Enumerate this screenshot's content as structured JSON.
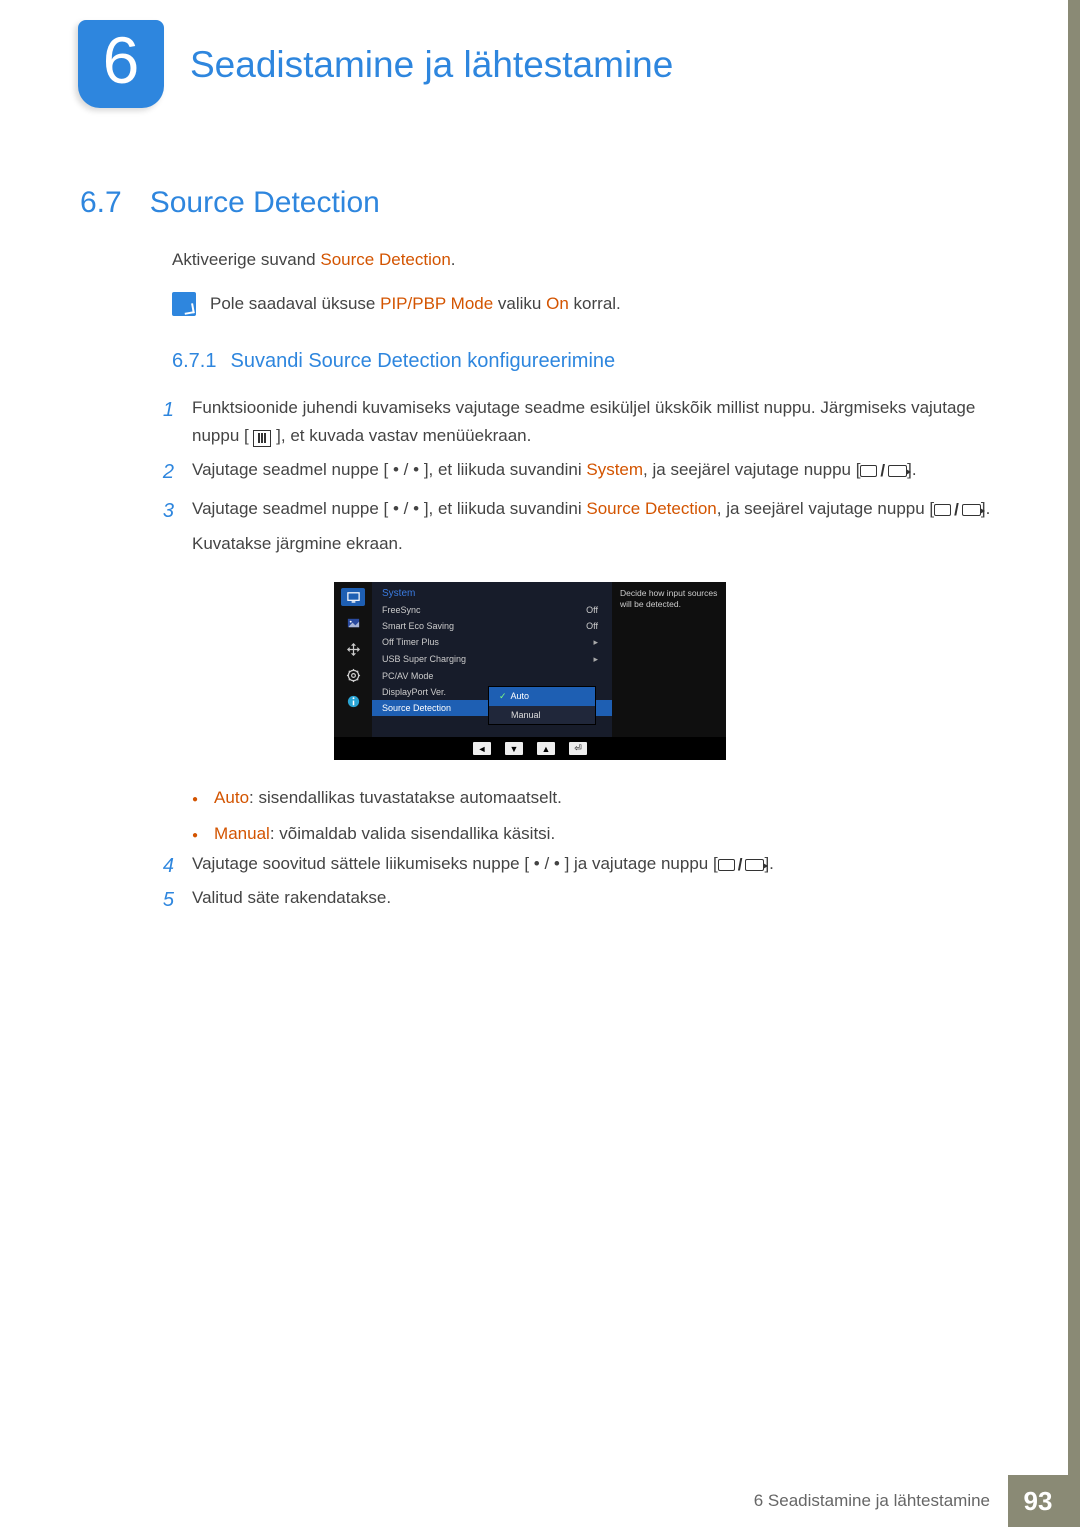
{
  "chapter": {
    "number": "6",
    "title": "Seadistamine ja lähtestamine"
  },
  "section": {
    "number": "6.7",
    "title": "Source Detection"
  },
  "intro": {
    "prefix": "Aktiveerige suvand ",
    "hl": "Source Detection",
    "suffix": "."
  },
  "note": {
    "p1": "Pole saadaval üksuse ",
    "hl1": "PIP/PBP Mode",
    "p2": " valiku ",
    "hl2": "On",
    "p3": " korral."
  },
  "subsection": {
    "number": "6.7.1",
    "title": "Suvandi Source Detection konfigureerimine"
  },
  "steps": {
    "s1": {
      "num": "1",
      "text_a": "Funktsioonide juhendi kuvamiseks vajutage seadme esiküljel ükskõik millist nuppu. Järgmiseks vajutage nuppu [ ",
      "text_b": " ], et kuvada vastav menüüekraan."
    },
    "s2": {
      "num": "2",
      "vaj": "Vajutage seadmel nuppe [",
      "dots": " • / • ",
      "mid": "], et liikuda suvandini ",
      "hl": "System",
      "post": ", ja seejärel vajutage nuppu [",
      "end": "]."
    },
    "s3": {
      "num": "3",
      "vaj": "Vajutage seadmel nuppe [",
      "dots": " • / • ",
      "mid": "], et liikuda suvandini ",
      "hl": "Source Detection",
      "post": ", ja seejärel vajutage nuppu [",
      "end": "].",
      "desc": "Kuvatakse järgmine ekraan."
    },
    "s4": {
      "num": "4",
      "a": "Vajutage soovitud sättele liikumiseks nuppe [",
      "dots": " • / • ",
      "b": "] ja vajutage nuppu [",
      "c": "]."
    },
    "s5": {
      "num": "5",
      "text": "Valitud säte rakendatakse."
    }
  },
  "bullets": {
    "b1": {
      "hl": "Auto",
      "text": ": sisendallikas tuvastatakse automaatselt."
    },
    "b2": {
      "hl": "Manual",
      "text": ": võimaldab valida sisendallika käsitsi."
    }
  },
  "osd": {
    "heading": "System",
    "rows": [
      {
        "label": "FreeSync",
        "value": "Off"
      },
      {
        "label": "Smart Eco Saving",
        "value": "Off"
      },
      {
        "label": "Off Timer Plus",
        "value": "▸"
      },
      {
        "label": "USB Super Charging",
        "value": "▸"
      },
      {
        "label": "PC/AV Mode",
        "value": ""
      },
      {
        "label": "DisplayPort Ver.",
        "value": ""
      },
      {
        "label": "Source Detection",
        "value": "",
        "sel": true
      }
    ],
    "popup": {
      "opt1": "Auto",
      "opt2": "Manual"
    },
    "desc": "Decide how input sources will be detected.",
    "nav": [
      "◄",
      "▼",
      "▲",
      "⏎"
    ]
  },
  "footer": {
    "text": "6 Seadistamine ja lähtestamine",
    "page": "93"
  }
}
